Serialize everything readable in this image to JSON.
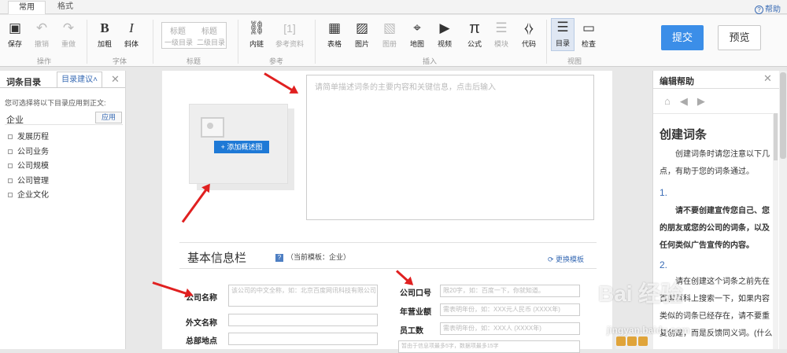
{
  "tabs": [
    "常用",
    "格式"
  ],
  "help": "帮助",
  "toolbar": {
    "save": "保存",
    "undo": "撤销",
    "redo": "重做",
    "bold": "加粗",
    "italic": "斜体",
    "h1": "标题",
    "h2": "标题",
    "h1_sub": "一级目录",
    "h2_sub": "二级目录",
    "link": "内链",
    "ref": "参考资料",
    "ref_icon": "[1]",
    "table": "表格",
    "image": "图片",
    "atlas": "图册",
    "map": "地图",
    "video": "视频",
    "formula": "公式",
    "module": "模块",
    "code": "代码",
    "toc": "目录",
    "check": "检查",
    "groups": [
      "操作",
      "字体",
      "标题",
      "参考",
      "插入",
      "视图"
    ]
  },
  "submit": "提交",
  "preview": "预览",
  "left_panel": {
    "title": "词条目录",
    "tab": "目录建议",
    "tip": "您可选择将以下目录应用到正文:",
    "category": "企业",
    "apply": "应用",
    "items": [
      "发展历程",
      "公司业务",
      "公司规模",
      "公司管理",
      "企业文化"
    ]
  },
  "editor": {
    "add_image": "+ 添加概述图",
    "summary_placeholder": "请简单描述词条的主要内容和关键信息，点击后输入",
    "basic_info_title": "基本信息栏",
    "template_label": "（当前模板：企业）",
    "switch_template": "更换模板",
    "fields": {
      "company_name": "公司名称",
      "company_name_ph": "该公司的中文全称，如：北京百度网讯科技有限公司",
      "english_name": "外文名称",
      "hq": "总部地点",
      "slogan": "公司口号",
      "slogan_ph": "限20字，如：百度一下，你就知道。",
      "revenue": "年营业额",
      "revenue_ph": "需表明年份，如：XXX元人民币 (XXXX年)",
      "employees": "员工数",
      "employees_ph": "需表明年份，如：XXX人 (XXXX年)",
      "more_ph": "暂由于信息项最多5字，数据项最多15字"
    }
  },
  "right_panel": {
    "title": "编辑帮助",
    "heading": "创建词条",
    "intro": "创建词条时请您注意以下几点，有助于您的词条通过。",
    "n1": "1.",
    "p1": "请不要创建宣传您自己、您的朋友或您的公司的词条，以及任何类似广告宣传的内容。",
    "n2": "2.",
    "p2": "请在创建这个词条之前先在百度百科上搜索一下，如果内容类似的词条已经存在，请不要重复创建，而是反馈同义词。(什么"
  },
  "watermark": "Bai 经验",
  "watermark_sub": "jingyan.baidu.com"
}
